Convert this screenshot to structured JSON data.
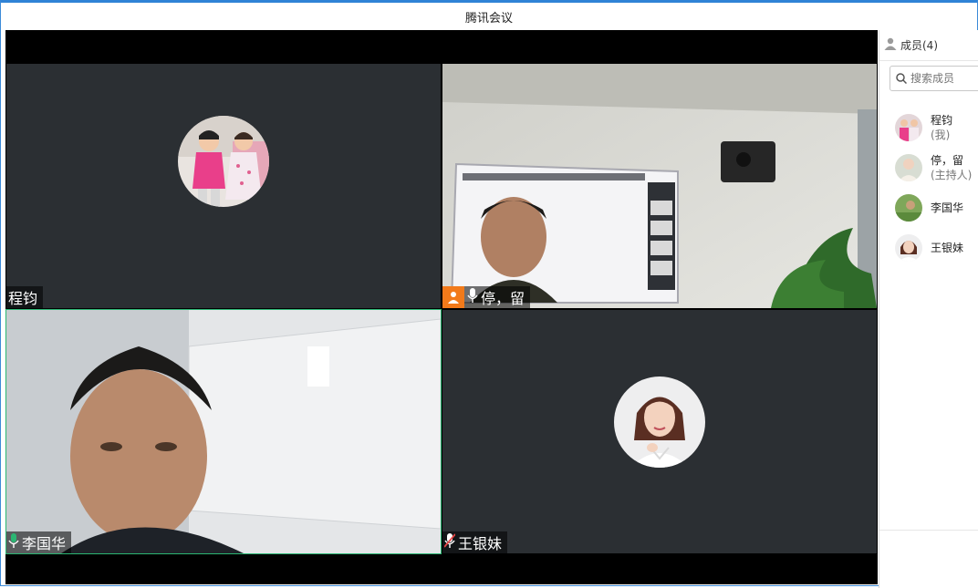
{
  "window": {
    "title": "腾讯会议"
  },
  "tiles": [
    {
      "name": "程钧",
      "mode": "avatar"
    },
    {
      "name": "停，留",
      "mode": "video",
      "host": true
    },
    {
      "name": "李国华",
      "mode": "video",
      "mic": "on"
    },
    {
      "name": "王银妹",
      "mode": "avatar",
      "mic": "muted"
    }
  ],
  "sidebar": {
    "members_label": "成员(4)",
    "search_placeholder": "搜索成员",
    "members": [
      {
        "name": "程钧",
        "role": "(我)"
      },
      {
        "name": "停，留",
        "role": "(主持人)"
      },
      {
        "name": "李国华",
        "role": ""
      },
      {
        "name": "王银妹",
        "role": ""
      }
    ]
  },
  "colors": {
    "accent": "#2f83d6",
    "host_badge": "#f27a1a",
    "mic_on": "#2bb673",
    "active_border": "#2bb673",
    "tile_bg": "#2b2f33"
  }
}
